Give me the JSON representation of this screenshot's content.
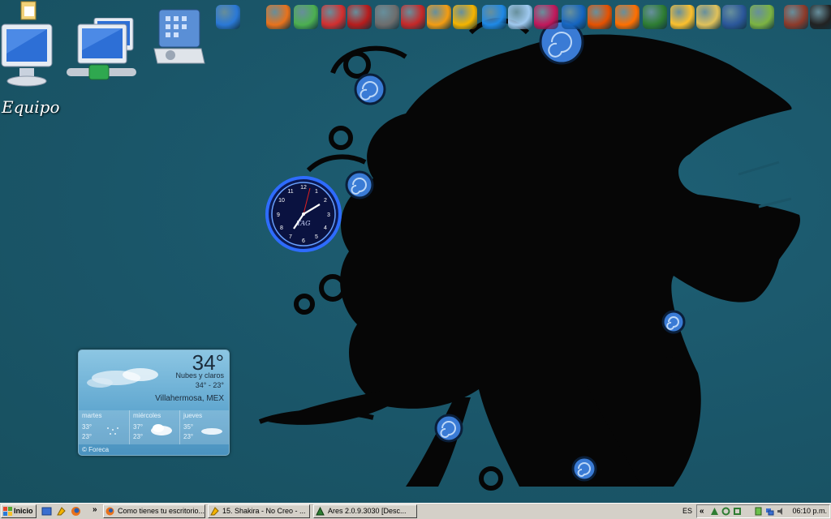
{
  "desktop": {
    "icon_label": "Equipo"
  },
  "dock": {
    "icons": [
      {
        "name": "internet-explorer-icon",
        "color": "#2a78d6"
      },
      {
        "name": "firefox-icon",
        "color": "#e8721c"
      },
      {
        "name": "messenger-icon",
        "color": "#4caf50"
      },
      {
        "name": "no-entry-icon",
        "color": "#d32f2f"
      },
      {
        "name": "red-app-icon",
        "color": "#b71c1c"
      },
      {
        "name": "webcam-icon",
        "color": "#6d6d6d"
      },
      {
        "name": "pdf-icon",
        "color": "#c62828"
      },
      {
        "name": "media-player-icon",
        "color": "#f39c12"
      },
      {
        "name": "winamp-icon",
        "color": "#f4b400"
      },
      {
        "name": "quicktime-icon",
        "color": "#1e88e5"
      },
      {
        "name": "itunes-icon",
        "color": "#9fc9f0"
      },
      {
        "name": "orb-icon",
        "color": "#c2185b"
      },
      {
        "name": "google-earth-icon",
        "color": "#1565c0"
      },
      {
        "name": "spinner-icon",
        "color": "#e65100"
      },
      {
        "name": "music-disc-icon",
        "color": "#ff6f00"
      },
      {
        "name": "ares-icon",
        "color": "#2e7d32"
      },
      {
        "name": "notepad-pen-icon",
        "color": "#fbc02d"
      },
      {
        "name": "folder-icon",
        "color": "#e0c15a"
      },
      {
        "name": "word-icon",
        "color": "#2b579a"
      },
      {
        "name": "document-icon",
        "color": "#7cb342"
      },
      {
        "name": "game-icon",
        "color": "#8d3a2a"
      },
      {
        "name": "media-control-icon",
        "color": "#222222"
      }
    ]
  },
  "clock": {
    "brand": "TAG"
  },
  "weather": {
    "temperature": "34°",
    "condition": "Nubes y claros",
    "range": "34° - 23°",
    "city": "Villahermosa, MEX",
    "forecast": [
      {
        "day": "martes",
        "hi": "33°",
        "lo": "23°"
      },
      {
        "day": "miércoles",
        "hi": "37°",
        "lo": "23°"
      },
      {
        "day": "jueves",
        "hi": "35°",
        "lo": "23°"
      }
    ],
    "brand": "© Foreca"
  },
  "taskbar": {
    "start_label": "Inicio",
    "tasks": [
      {
        "label": "Como tienes tu escritorio..."
      },
      {
        "label": "15. Shakira - No Creo - ..."
      },
      {
        "label": "Ares 2.0.9.3030  [Desc..."
      }
    ],
    "language": "ES",
    "clock": "06:10 p.m."
  },
  "colors": {
    "desktop_bg": "#1a5568",
    "taskbar_bg": "#d4d0c8",
    "silhouette": "#050505",
    "swirl_blue": "#3a7bd5"
  }
}
